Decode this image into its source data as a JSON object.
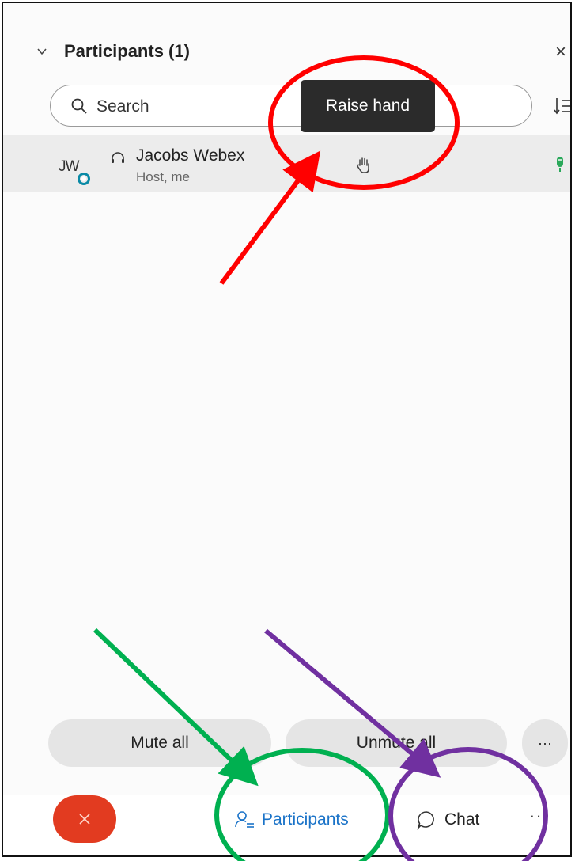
{
  "panel": {
    "title": "Participants (1)",
    "search_placeholder": "Search",
    "tooltip": "Raise hand"
  },
  "participants": [
    {
      "initials": "JW",
      "name": "Jacobs Webex",
      "role": "Host, me"
    }
  ],
  "actions": {
    "mute_all": "Mute all",
    "unmute_all": "Unmute all",
    "more": "···"
  },
  "toolbar": {
    "participants_label": "Participants",
    "chat_label": "Chat",
    "more": "···"
  },
  "colors": {
    "leave_button": "#e23b20",
    "participants_accent": "#1a73c8",
    "annotation_red": "#ff0000",
    "annotation_green": "#00b050",
    "annotation_purple": "#7030a0"
  }
}
